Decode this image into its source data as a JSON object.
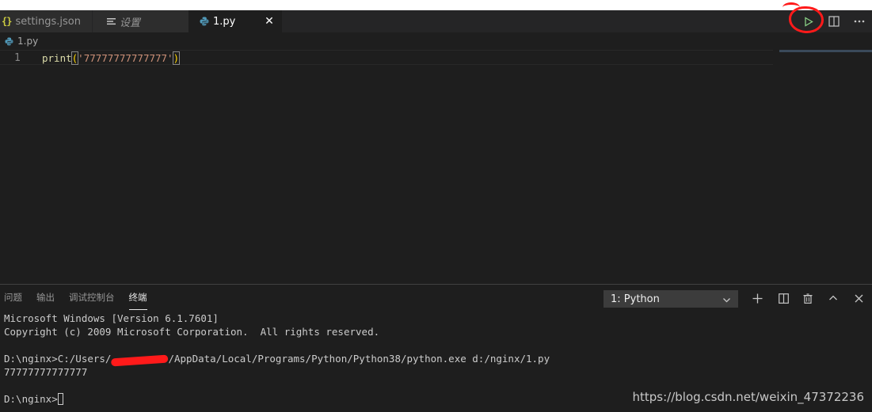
{
  "tabs": [
    {
      "label": "settings.json",
      "icon": "json-icon"
    },
    {
      "label": "设置",
      "icon": "preview-icon"
    },
    {
      "label": "1.py",
      "icon": "python-icon",
      "active": true
    }
  ],
  "tab_close_glyph": "✕",
  "editor_actions": [
    {
      "name": "run-python-file",
      "icon": "play-icon"
    },
    {
      "name": "split-editor",
      "icon": "split-editor-icon"
    },
    {
      "name": "more-actions",
      "icon": "ellipsis-icon"
    }
  ],
  "breadcrumb": {
    "file": "1.py"
  },
  "editor": {
    "line_number": "1",
    "code": {
      "fn": "print",
      "open": "(",
      "string": "'77777777777777'",
      "close": ")"
    }
  },
  "panel": {
    "tabs": [
      "问题",
      "输出",
      "调试控制台",
      "终端"
    ],
    "active_tab": "终端",
    "terminal_select": "1: Python",
    "actions": [
      "plus-icon",
      "split-terminal-icon",
      "trash-icon",
      "chevron-up-icon",
      "close-icon"
    ]
  },
  "terminal": {
    "line1": "Microsoft Windows [Version 6.1.7601]",
    "line2": "Copyright (c) 2009 Microsoft Corporation.  All rights reserved.",
    "cmd_prefix": "D:\\nginx>C:/Users/",
    "cmd_suffix": "/AppData/Local/Programs/Python/Python38/python.exe d:/nginx/1.py",
    "output": "77777777777777",
    "prompt": "D:\\nginx>"
  },
  "watermark": "https://blog.csdn.net/weixin_47372236",
  "colors": {
    "annotation_red": "#ff1a1a",
    "string": "#ce9178",
    "function": "#dcdcaa"
  }
}
